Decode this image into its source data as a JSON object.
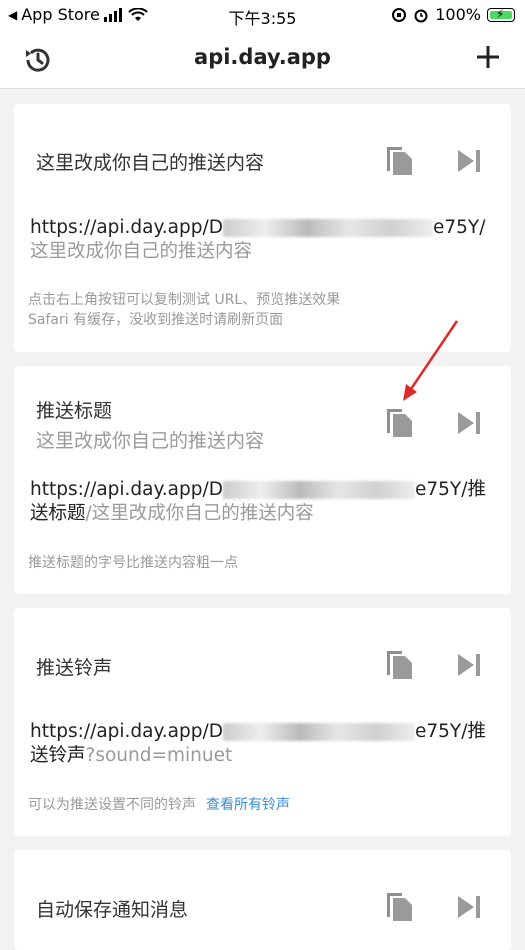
{
  "status_bar": {
    "back_app": "App Store",
    "time": "下午3:55",
    "battery": "100%"
  },
  "nav": {
    "title": "api.day.app"
  },
  "cards": [
    {
      "title": "这里改成你自己的推送内容",
      "url_visible_start": "https://api.day.app/D",
      "url_visible_end": "e75Y/",
      "url_suffix": "这里改成你自己的推送内容",
      "hint_line1": "点击右上角按钮可以复制测试 URL、预览推送效果",
      "hint_line2": "Safari 有缓存，没收到推送时请刷新页面"
    },
    {
      "title": "推送标题",
      "subtitle": "这里改成你自己的推送内容",
      "url_visible_start": "https://api.day.app/D",
      "url_visible_end": "e75Y/",
      "url_part": "推送标题",
      "url_suffix": "/这里改成你自己的推送内容",
      "hint_line1": "推送标题的字号比推送内容粗一点"
    },
    {
      "title": "推送铃声",
      "url_visible_start": "https://api.day.app/D",
      "url_visible_end": "e75Y/",
      "url_part": "推送铃声",
      "url_suffix": "?sound=minuet",
      "hint_line1": "可以为推送设置不同的铃声",
      "hint_link": "查看所有铃声"
    },
    {
      "title": "自动保存通知消息"
    }
  ],
  "colors": {
    "background": "#f2f2f2",
    "card": "#ffffff",
    "muted_text": "#9a9a9a",
    "link": "#3b8fd9",
    "arrow": "#e0282a",
    "battery_fill": "#4cd964"
  },
  "icons": [
    "history-icon",
    "plus-icon",
    "copy-icon",
    "send-icon",
    "signal-icon",
    "wifi-icon",
    "alarm-icon",
    "rotation-lock-icon"
  ]
}
